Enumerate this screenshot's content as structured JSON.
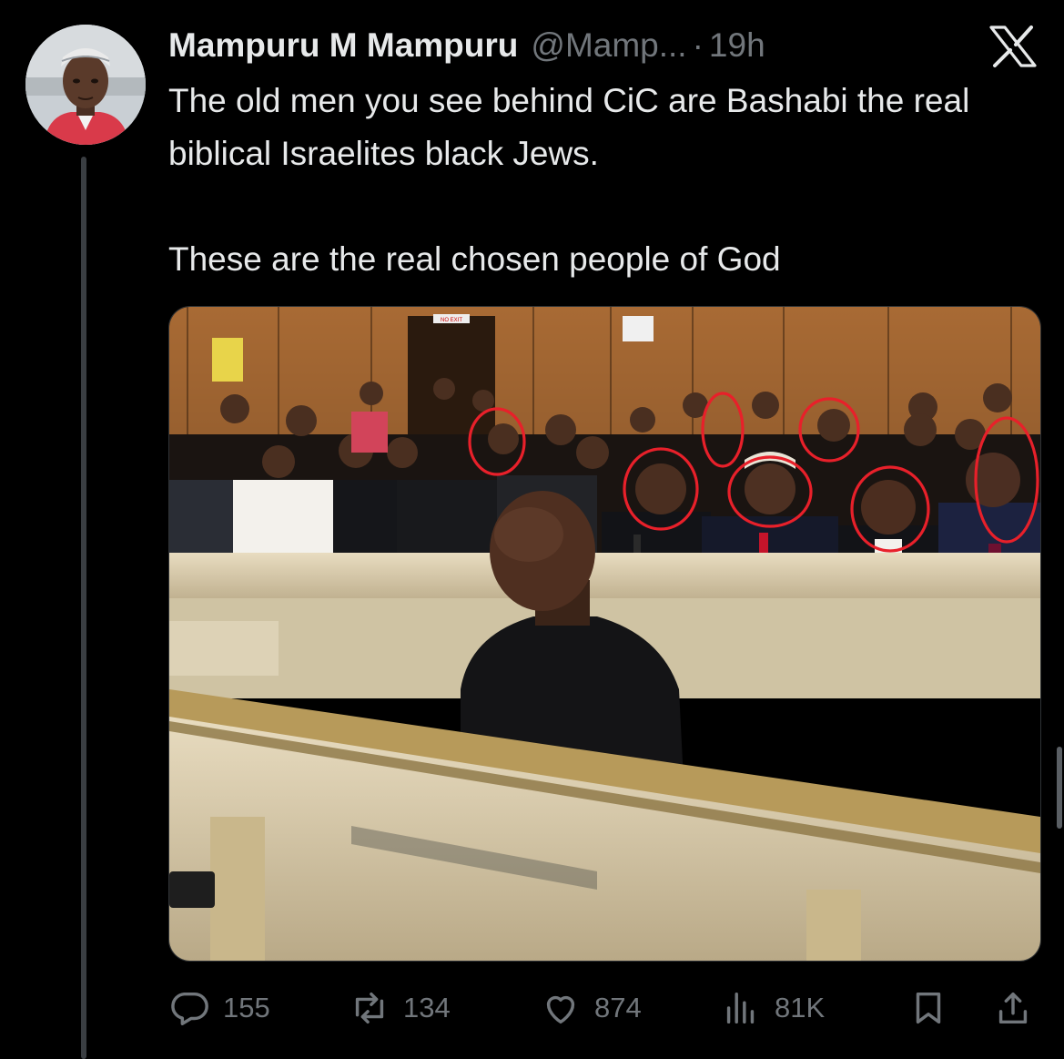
{
  "tweet": {
    "display_name": "Mampuru M Mampuru",
    "handle": "@Mamp...",
    "separator": "·",
    "time": "19h",
    "text_paragraphs": [
      "The old men you see behind CiC are Bashabi the real biblical Israelites black Jews.",
      "These are the real chosen people of God"
    ]
  },
  "media": {
    "signs": {
      "exit": "NO EXIT"
    }
  },
  "actions": {
    "reply_count": "155",
    "repost_count": "134",
    "like_count": "874",
    "views_count": "81K"
  },
  "icons": {
    "reply": "reply-icon",
    "repost": "repost-icon",
    "like": "heart-icon",
    "views": "views-icon",
    "bookmark": "bookmark-icon",
    "share": "share-icon",
    "x_logo": "x-logo-icon"
  },
  "colors": {
    "background": "#000000",
    "text": "#e7e9ea",
    "muted": "#71767b",
    "annotation_red": "#e8202a"
  }
}
